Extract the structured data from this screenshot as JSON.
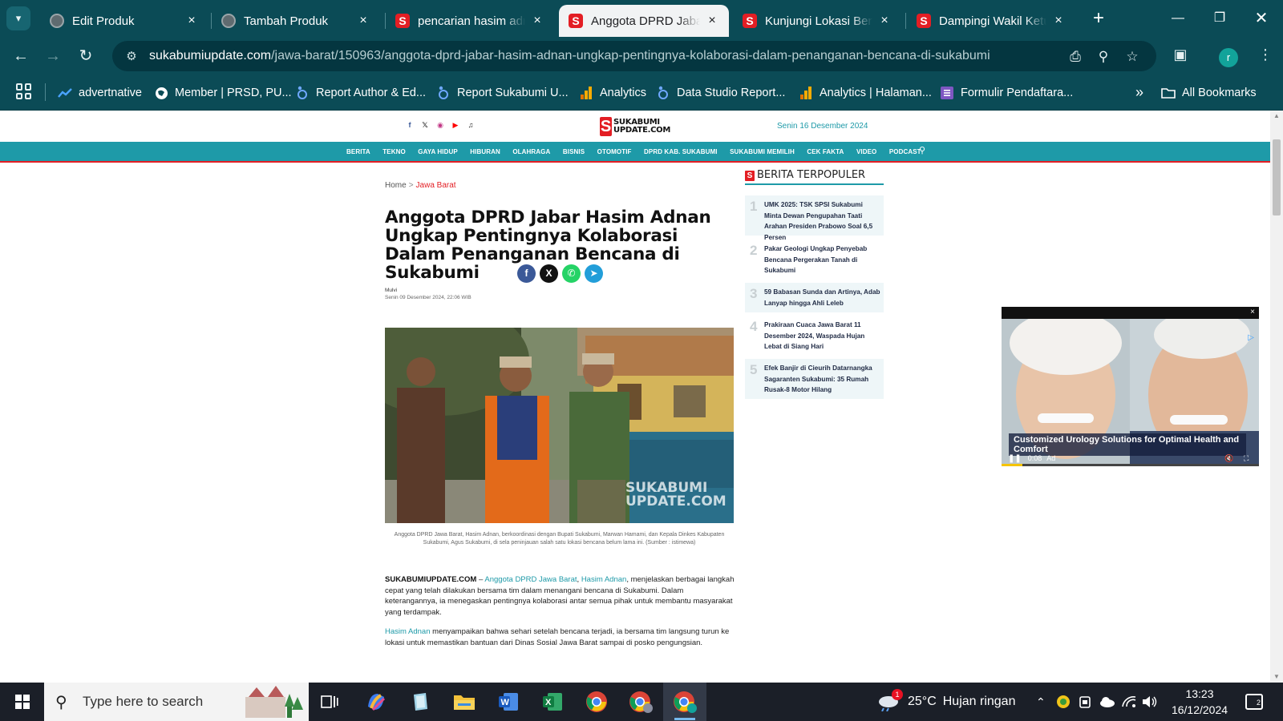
{
  "browser": {
    "tabs": [
      {
        "title": "Edit Produk",
        "favicon": "globe-icon",
        "active": false
      },
      {
        "title": "Tambah Produk",
        "favicon": "globe-icon",
        "active": false
      },
      {
        "title": "pencarian hasim adnan",
        "favicon": "sukabumi-s-icon",
        "active": false
      },
      {
        "title": "Anggota DPRD Jabar Hasim Adnan",
        "favicon": "sukabumi-s-icon",
        "active": true
      },
      {
        "title": "Kunjungi Lokasi Bencana",
        "favicon": "sukabumi-s-icon",
        "active": false
      },
      {
        "title": "Dampingi Wakil Ketua",
        "favicon": "sukabumi-s-icon",
        "active": false
      }
    ],
    "close_glyph": "×",
    "new_tab_glyph": "+",
    "url_host": "sukabumiupdate.com",
    "url_path": "/jawa-barat/150963/anggota-dprd-jabar-hasim-adnan-ungkap-pentingnya-kolaborasi-dalam-penanganan-bencana-di-sukabumi",
    "profile_initial": "r",
    "bookmarks": [
      {
        "label": "advertnative",
        "icon": "trend-icon"
      },
      {
        "label": "Member | PRSD, PU...",
        "icon": "globe-icon"
      },
      {
        "label": "Report Author & Ed...",
        "icon": "studio-icon"
      },
      {
        "label": "Report Sukabumi U...",
        "icon": "studio-icon"
      },
      {
        "label": "Analytics",
        "icon": "analytics-icon"
      },
      {
        "label": "Data Studio Report...",
        "icon": "studio-icon"
      },
      {
        "label": "Analytics | Halaman...",
        "icon": "analytics-icon"
      },
      {
        "label": "Formulir Pendaftara...",
        "icon": "form-icon"
      }
    ],
    "bookmarks_more": "»",
    "all_bookmarks": "All Bookmarks"
  },
  "site": {
    "logo_line1": "SUKABUMI",
    "logo_line2": "UPDATE.COM",
    "header_date": "Senin 16 Desember 2024",
    "nav": [
      "BERITA",
      "TEKNO",
      "GAYA HIDUP",
      "HIBURAN",
      "OLAHRAGA",
      "BISNIS",
      "OTOMOTIF",
      "DPRD KAB. SUKABUMI",
      "SUKABUMI MEMILIH",
      "CEK FAKTA",
      "VIDEO",
      "PODCAST"
    ]
  },
  "article": {
    "breadcrumb_home": "Home",
    "breadcrumb_sep": ">",
    "breadcrumb_current": "Jawa Barat",
    "title": "Anggota DPRD Jabar Hasim Adnan Ungkap Pentingnya Kolaborasi Dalam Penanganan Bencana di Sukabumi",
    "author": "Mulvi",
    "published": "Senin 09 Desember 2024, 22:06 WIB",
    "watermark_1": "SUKABUMI",
    "watermark_2": "UPDATE.COM",
    "caption": "Anggota DPRD Jawa Barat, Hasim Adnan, berkoordinasi dengan Bupati Sukabumi, Marwan Hamami, dan Kepala Dinkes Kabupaten Sukabumi, Agus Sukabumi, di sela peninjauan salah satu lokasi bencana belum lama ini. (Sumber : istimewa)",
    "p1_source": "SUKABUMIUPDATE.COM",
    "p1_dash": " – ",
    "p1_link1": "Anggota DPRD Jawa Barat",
    "p1_comma": ", ",
    "p1_link2": "Hasim Adnan",
    "p1_rest": ", menjelaskan berbagai langkah cepat yang telah dilakukan bersama tim dalam menangani bencana di Sukabumi. Dalam keterangannya, ia menegaskan pentingnya kolaborasi antar semua pihak untuk membantu masyarakat yang terdampak.",
    "p2_link": "Hasim Adnan",
    "p2_rest": " menyampaikan bahwa sehari setelah bencana terjadi, ia bersama tim langsung turun ke lokasi untuk memastikan bantuan dari Dinas Sosial Jawa Barat sampai di posko pengungsian."
  },
  "sidebar": {
    "title": "BERITA TERPOPULER",
    "items": [
      {
        "num": "1",
        "text": "UMK 2025: TSK SPSI Sukabumi Minta Dewan Pengupahan Taati Arahan Presiden Prabowo Soal 6,5 Persen"
      },
      {
        "num": "2",
        "text": "Pakar Geologi Ungkap Penyebab Bencana Pergerakan Tanah di Sukabumi"
      },
      {
        "num": "3",
        "text": "59 Babasan Sunda dan Artinya, Adab Lanyap hingga Ahli Leleb"
      },
      {
        "num": "4",
        "text": "Prakiraan Cuaca Jawa Barat 11 Desember 2024, Waspada Hujan Lebat di Siang Hari"
      },
      {
        "num": "5",
        "text": "Efek Banjir di Cieurih Datarnangka Sagaranten Sukabumi: 35 Rumah Rusak-8 Motor Hilang"
      }
    ]
  },
  "ad": {
    "caption": "Customized Urology Solutions for Optimal Health and Comfort",
    "time": "0:08",
    "label": "Ad",
    "close": "×",
    "progress": 0.08
  },
  "taskbar": {
    "search_placeholder": "Type here to search",
    "weather_badge": "1",
    "temperature": "25°C",
    "weather": "Hujan ringan",
    "time": "13:23",
    "date": "16/12/2024",
    "notification_count": "2"
  },
  "colors": {
    "chrome": "#0b4b56",
    "site_teal": "#1e9aa8",
    "brand_red": "#e31e24"
  }
}
